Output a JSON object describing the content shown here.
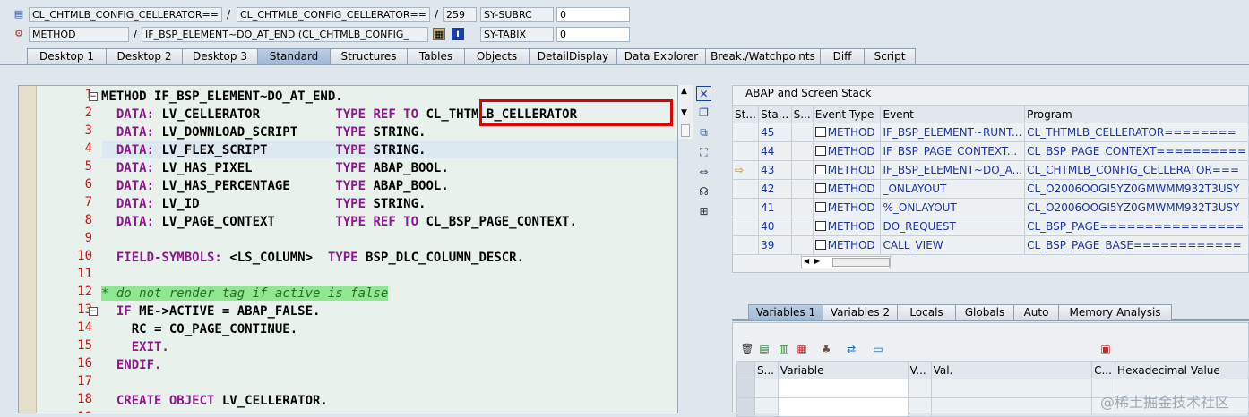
{
  "header": {
    "row1": {
      "field1": "CL_CHTMLB_CONFIG_CELLERATOR==",
      "sep1": "/",
      "field2": "CL_CHTMLB_CONFIG_CELLERATOR==",
      "sep2": "/",
      "line": "259",
      "sysvar": "SY-SUBRC",
      "value": "0"
    },
    "row2": {
      "field1": "METHOD",
      "sep1": "/",
      "field2": "IF_BSP_ELEMENT~DO_AT_END (CL_CHTMLB_CONFIG_",
      "sysvar": "SY-TABIX",
      "value": "0"
    }
  },
  "tabs": [
    "Desktop 1",
    "Desktop 2",
    "Desktop 3",
    "Standard",
    "Structures",
    "Tables",
    "Objects",
    "DetailDisplay",
    "Data Explorer",
    "Break./Watchpoints",
    "Diff",
    "Script"
  ],
  "active_tab": "Standard",
  "code": {
    "line_numbers": [
      "1",
      "2",
      "3",
      "4",
      "5",
      "6",
      "7",
      "8",
      "9",
      "10",
      "11",
      "12",
      "13",
      "14",
      "15",
      "16",
      "17",
      "18",
      "19"
    ],
    "lines": [
      [
        [
          "nm",
          "METHOD IF_BSP_ELEMENT~DO_AT_END."
        ]
      ],
      [
        [
          "kw",
          "  DATA: "
        ],
        [
          "nm",
          "LV_CELLERATOR          "
        ],
        [
          "kw",
          "TYPE REF TO "
        ],
        [
          "nm",
          "CL_THTMLB_CELLERATOR"
        ]
      ],
      [
        [
          "kw",
          "  DATA: "
        ],
        [
          "nm",
          "LV_DOWNLOAD_SCRIPT     "
        ],
        [
          "kw",
          "TYPE "
        ],
        [
          "nm",
          "STRING."
        ]
      ],
      [
        [
          "kw",
          "  DATA: "
        ],
        [
          "nm",
          "LV_FLEX_SCRIPT         "
        ],
        [
          "kw",
          "TYPE "
        ],
        [
          "nm",
          "STRING."
        ]
      ],
      [
        [
          "kw",
          "  DATA: "
        ],
        [
          "nm",
          "LV_HAS_PIXEL           "
        ],
        [
          "kw",
          "TYPE "
        ],
        [
          "nm",
          "ABAP_BOOL."
        ]
      ],
      [
        [
          "kw",
          "  DATA: "
        ],
        [
          "nm",
          "LV_HAS_PERCENTAGE      "
        ],
        [
          "kw",
          "TYPE "
        ],
        [
          "nm",
          "ABAP_BOOL."
        ]
      ],
      [
        [
          "kw",
          "  DATA: "
        ],
        [
          "nm",
          "LV_ID                  "
        ],
        [
          "kw",
          "TYPE "
        ],
        [
          "nm",
          "STRING."
        ]
      ],
      [
        [
          "kw",
          "  DATA: "
        ],
        [
          "nm",
          "LV_PAGE_CONTEXT        "
        ],
        [
          "kw",
          "TYPE REF TO "
        ],
        [
          "nm",
          "CL_BSP_PAGE_CONTEXT."
        ]
      ],
      [],
      [
        [
          "kw",
          "  FIELD-SYMBOLS: "
        ],
        [
          "nm",
          "<LS_COLUMN>  "
        ],
        [
          "kw",
          "TYPE "
        ],
        [
          "nm",
          "BSP_DLC_COLUMN_DESCR."
        ]
      ],
      [],
      [
        [
          "cm",
          "* do not render tag if active is false"
        ]
      ],
      [
        [
          "kw",
          "  IF "
        ],
        [
          "nm",
          "ME->ACTIVE = ABAP_FALSE."
        ]
      ],
      [
        [
          "nm",
          "    RC = CO_PAGE_CONTINUE."
        ]
      ],
      [
        [
          "kw",
          "    EXIT."
        ]
      ],
      [
        [
          "kw",
          "  ENDIF."
        ]
      ],
      [],
      [
        [
          "kw",
          "  CREATE OBJECT "
        ],
        [
          "nm",
          "LV_CELLERATOR."
        ]
      ],
      []
    ]
  },
  "stack": {
    "title": "ABAP and Screen Stack",
    "columns": [
      "St...",
      "Sta...",
      "S...",
      "Event Type",
      "Event",
      "Program"
    ],
    "rows": [
      {
        "level": "45",
        "type": "METHOD",
        "event": "IF_BSP_ELEMENT~RUNT...",
        "program": "CL_THTMLB_CELLERATOR========"
      },
      {
        "level": "44",
        "type": "METHOD",
        "event": "IF_BSP_PAGE_CONTEXT...",
        "program": "CL_BSP_PAGE_CONTEXT=========="
      },
      {
        "level": "43",
        "type": "METHOD",
        "event": "IF_BSP_ELEMENT~DO_A...",
        "program": "CL_CHTMLB_CONFIG_CELLERATOR==="
      },
      {
        "level": "42",
        "type": "METHOD",
        "event": "_ONLAYOUT",
        "program": "CL_O2006OOGI5YZ0GMWMM932T3USY"
      },
      {
        "level": "41",
        "type": "METHOD",
        "event": "%_ONLAYOUT",
        "program": "CL_O2006OOGI5YZ0GMWMM932T3USY"
      },
      {
        "level": "40",
        "type": "METHOD",
        "event": "DO_REQUEST",
        "program": "CL_BSP_PAGE================"
      },
      {
        "level": "39",
        "type": "METHOD",
        "event": "CALL_VIEW",
        "program": "CL_BSP_PAGE_BASE============"
      }
    ]
  },
  "var_tabs": [
    "Variables 1",
    "Variables 2",
    "Locals",
    "Globals",
    "Auto",
    "Memory Analysis"
  ],
  "active_var_tab": "Variables 1",
  "var_columns": [
    "S...",
    "Variable",
    "V...",
    "Val.",
    "C...",
    "Hexadecimal Value"
  ],
  "watermark": "@稀土掘金技术社区"
}
